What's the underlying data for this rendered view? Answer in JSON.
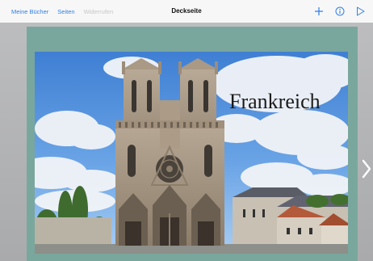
{
  "toolbar": {
    "my_books_label": "Meine Bücher",
    "pages_label": "Seiten",
    "undo_label": "Widerrufen",
    "title": "Deckseite",
    "add_icon": "plus-icon",
    "info_icon": "info-icon",
    "play_icon": "play-icon"
  },
  "slide": {
    "title": "Frankreich",
    "image": "cathedral-photo",
    "next_icon": "chevron-right-icon"
  },
  "colors": {
    "accent": "#2f7fe6",
    "slide_frame": "#7aa79d",
    "canvas_background": "#b3b4b6",
    "toolbar_background": "#f7f7f7"
  }
}
